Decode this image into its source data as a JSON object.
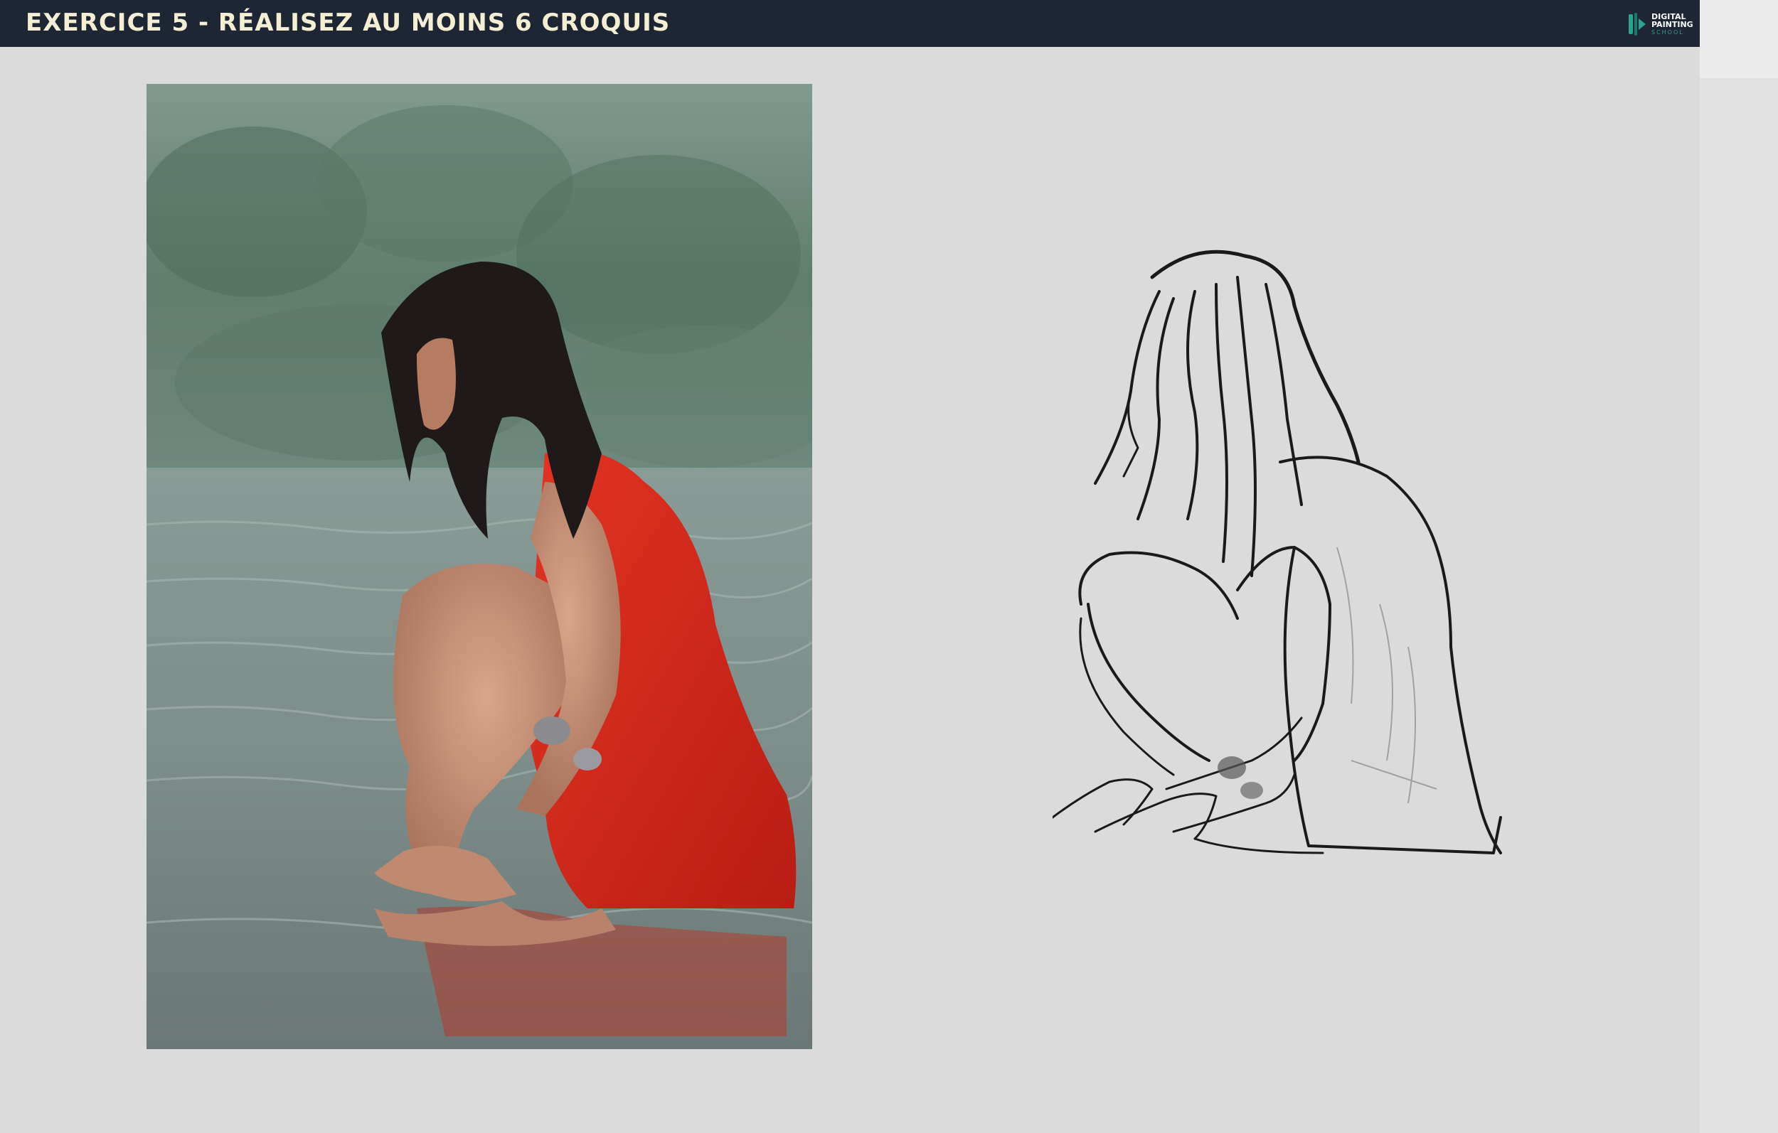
{
  "header": {
    "title": "EXERCICE 5 - RÉALISEZ AU MOINS 6 CROQUIS",
    "logo": {
      "line1": "DIGITAL",
      "line2": "PAINTING",
      "line3": "SCHOOL",
      "icon": "brush-logo-icon"
    }
  },
  "colors": {
    "header_bg": "#1e2533",
    "title_text": "#f3eed4",
    "page_bg": "#dbdbdb",
    "dress_red": "#d62a1e",
    "logo_accent": "#2aa390"
  }
}
